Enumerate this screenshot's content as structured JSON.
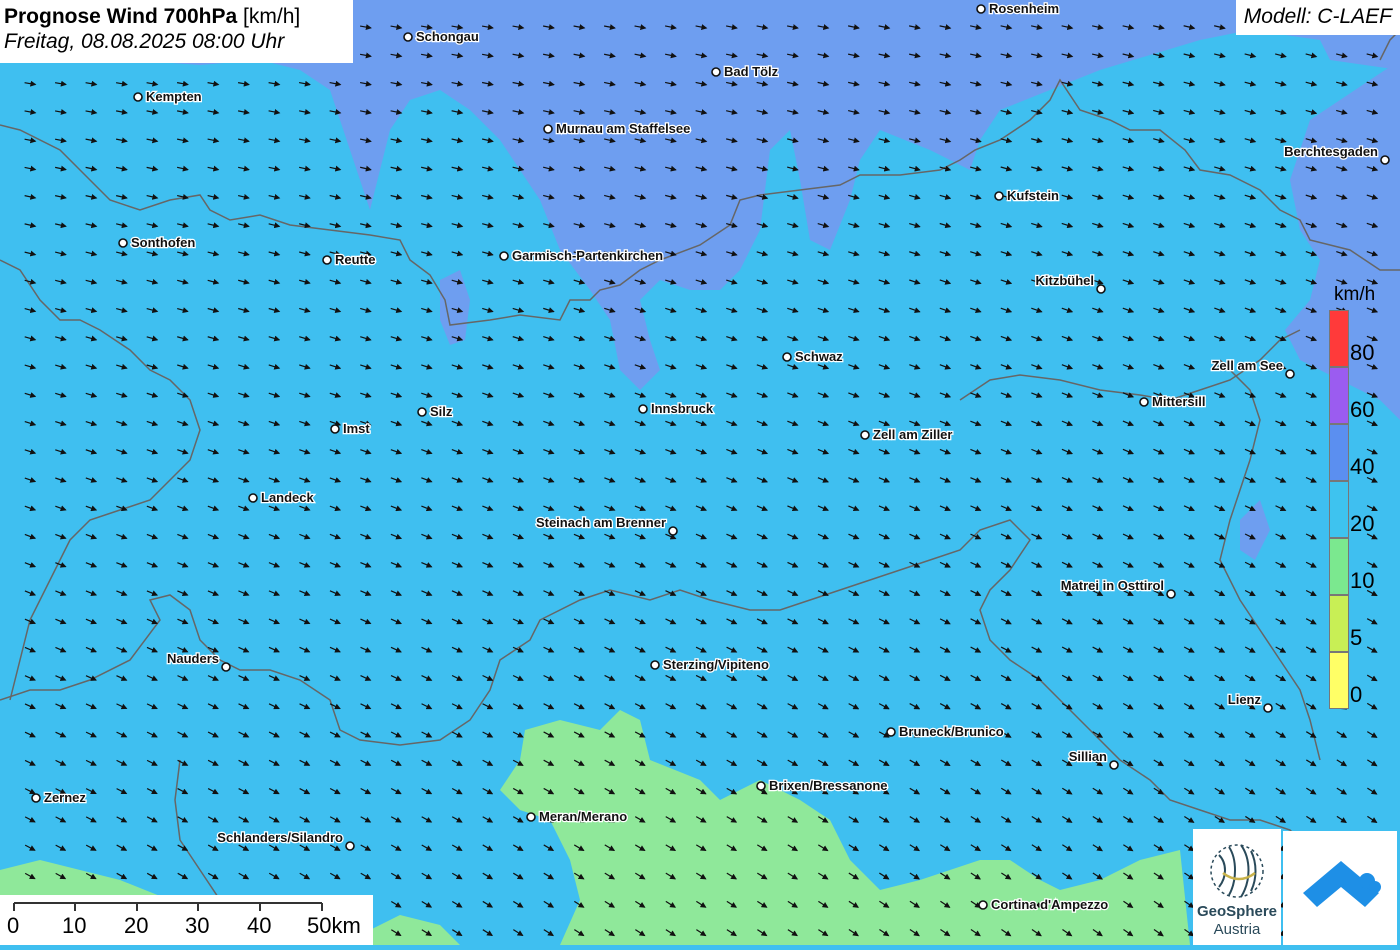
{
  "title": {
    "bold": "Prognose Wind 700hPa",
    "unit": " [km/h]",
    "datetime": "Freitag, 08.08.2025 08:00 Uhr"
  },
  "model": "Modell: C-LAEF",
  "legend": {
    "unit": "km/h",
    "entries": [
      {
        "label": "80",
        "color": "#ff3a3a"
      },
      {
        "label": "60",
        "color": "#9b5cf0"
      },
      {
        "label": "40",
        "color": "#5b8ff0"
      },
      {
        "label": "20",
        "color": "#3ec3ef"
      },
      {
        "label": "10",
        "color": "#7be88f"
      },
      {
        "label": "5",
        "color": "#c8ef55"
      },
      {
        "label": "0",
        "color": "#ffff66"
      }
    ]
  },
  "scale": {
    "labels": [
      "0",
      "10",
      "20",
      "30",
      "40",
      "50km"
    ]
  },
  "cities": [
    {
      "name": "Rosenheim",
      "side": "right"
    },
    {
      "name": "Schongau",
      "side": "right"
    },
    {
      "name": "Bad Tölz",
      "side": "right"
    },
    {
      "name": "Kempten",
      "side": "right"
    },
    {
      "name": "Murnau am Staffelsee",
      "side": "right"
    },
    {
      "name": "Berchtesgaden",
      "side": "left"
    },
    {
      "name": "Kufstein",
      "side": "right"
    },
    {
      "name": "Sonthofen",
      "side": "right"
    },
    {
      "name": "Reutte",
      "side": "right"
    },
    {
      "name": "Garmisch-Partenkirchen",
      "side": "right"
    },
    {
      "name": "Kitzbühel",
      "side": "left"
    },
    {
      "name": "Schwaz",
      "side": "right"
    },
    {
      "name": "Zell am See",
      "side": "left"
    },
    {
      "name": "Mittersill",
      "side": "right"
    },
    {
      "name": "Silz",
      "side": "right"
    },
    {
      "name": "Innsbruck",
      "side": "right"
    },
    {
      "name": "Imst",
      "side": "right"
    },
    {
      "name": "Zell am Ziller",
      "side": "right"
    },
    {
      "name": "Landeck",
      "side": "right"
    },
    {
      "name": "Steinach am Brenner",
      "side": "left"
    },
    {
      "name": "Matrei in Osttirol",
      "side": "left"
    },
    {
      "name": "Nauders",
      "side": "left"
    },
    {
      "name": "Sterzing/Vipiteno",
      "side": "right"
    },
    {
      "name": "Lienz",
      "side": "left"
    },
    {
      "name": "Bruneck/Brunico",
      "side": "right"
    },
    {
      "name": "Sillian",
      "side": "left"
    },
    {
      "name": "Brixen/Bressanone",
      "side": "right"
    },
    {
      "name": "Zernez",
      "side": "right"
    },
    {
      "name": "Meran/Merano",
      "side": "right"
    },
    {
      "name": "Schlanders/Silandro",
      "side": "left"
    },
    {
      "name": "Cortina d'Ampezzo",
      "side": "right"
    }
  ],
  "logos": {
    "geosphere_line1": "GeoSphere",
    "geosphere_line2": "Austria"
  },
  "colors": {
    "band_10_20": "#3fbff0",
    "band_20_40": "#6e9ef0",
    "band_5_10": "#8fe89a",
    "wind_arrow": "#111111"
  }
}
